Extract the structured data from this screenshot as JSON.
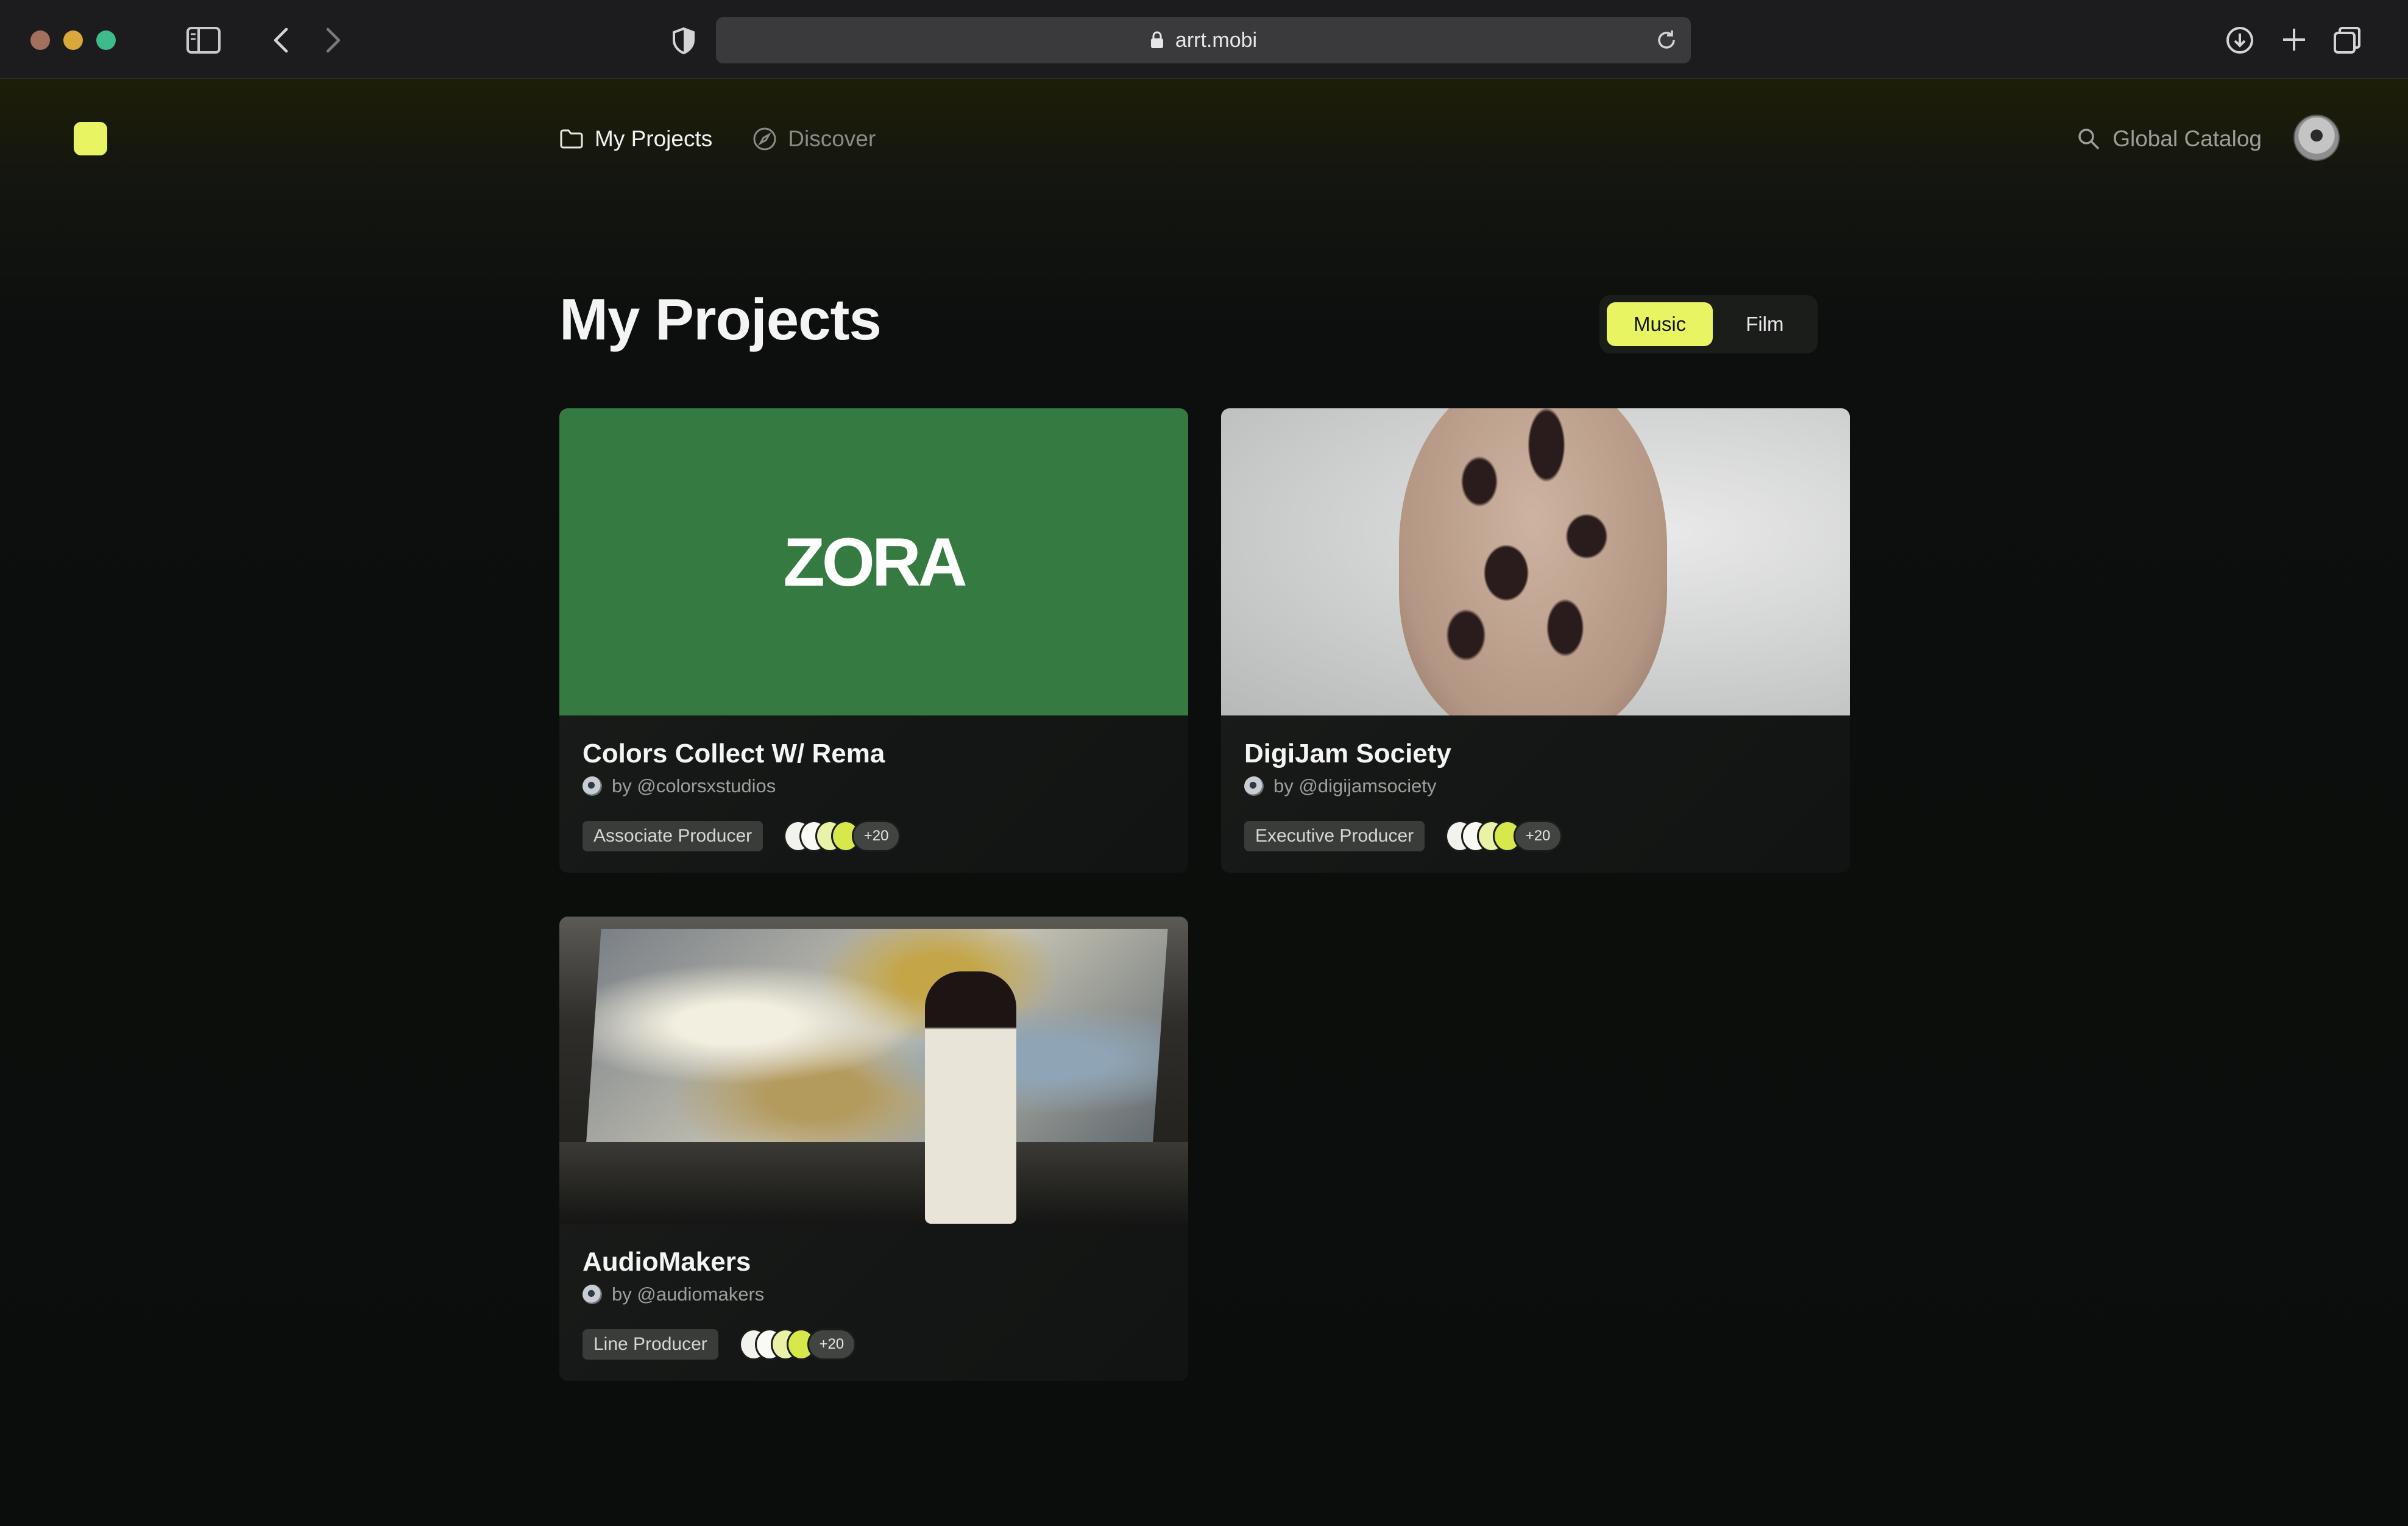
{
  "browser": {
    "url": "arrt.mobi"
  },
  "nav": {
    "items": [
      {
        "label": "My Projects",
        "icon": "folder-icon",
        "active": true
      },
      {
        "label": "Discover",
        "icon": "compass-icon",
        "active": false
      }
    ],
    "search_label": "Global Catalog"
  },
  "page": {
    "title": "My Projects",
    "toggle": [
      {
        "label": "Music",
        "selected": true
      },
      {
        "label": "Film",
        "selected": false
      }
    ]
  },
  "projects": [
    {
      "title": "Colors Collect W/ Rema",
      "by": "by @colorsxstudios",
      "role": "Associate Producer",
      "more": "+20",
      "image_text": "ZORA"
    },
    {
      "title": "DigiJam Society",
      "by": "by @digijamsociety",
      "role": "Executive Producer",
      "more": "+20"
    },
    {
      "title": "AudioMakers",
      "by": "by @audiomakers",
      "role": "Line Producer",
      "more": "+20"
    }
  ],
  "colors": {
    "accent": "#e8f461",
    "zora_green": "#357b41"
  }
}
